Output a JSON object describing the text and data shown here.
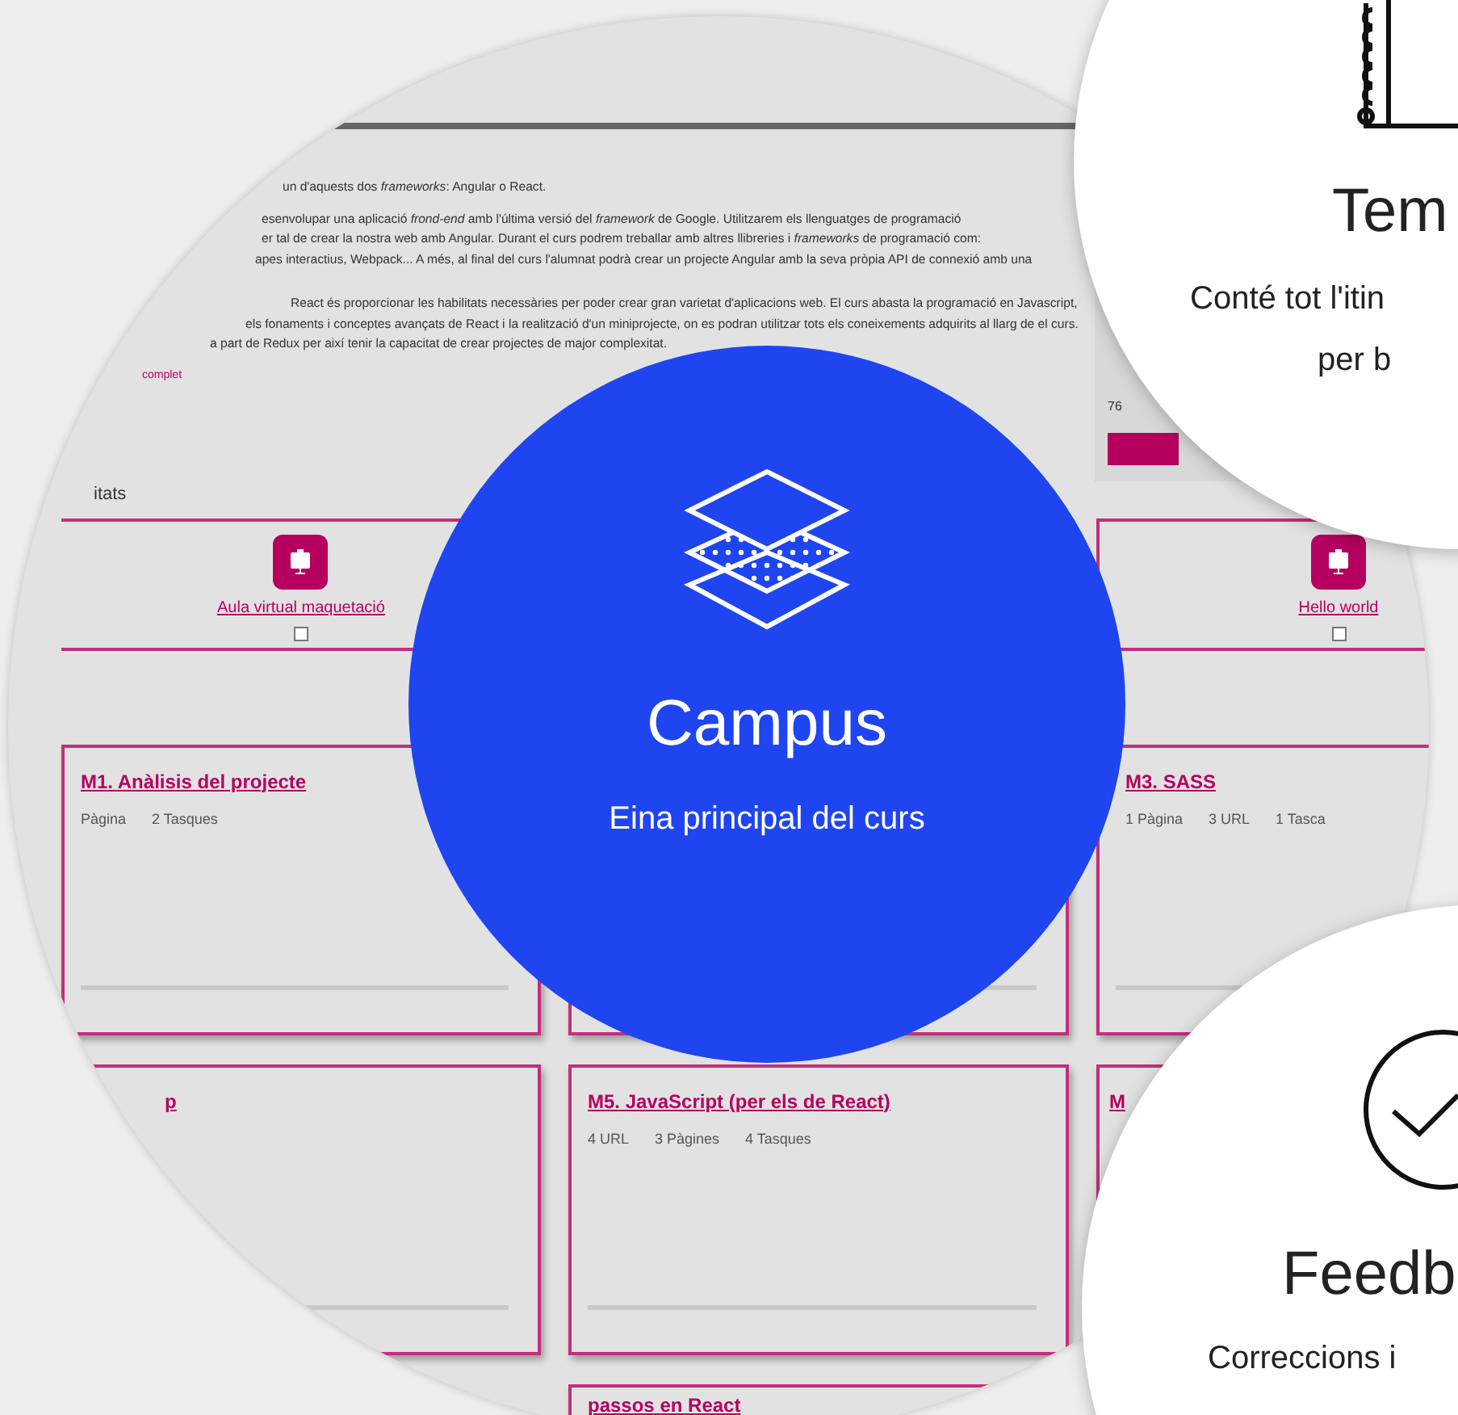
{
  "course_page": {
    "intro_lines": [
      "un d'aquests dos *frameworks*: Angular o React.",
      "esenvolupar una aplicació *frond-end* amb l'última versió del *framework* de Google. Utilitzarem els llenguatges de programació",
      "er tal de crear la nostra web amb Angular. Durant el curs podrem treballar amb altres llibreries i *frameworks* de programació com:",
      "apes interactius, Webpack... A més, al final del curs l'alumnat podrà crear un projecte Angular amb la seva pròpia API de connexió amb una",
      "React és proporcionar les habilitats necessàries per poder crear gran varietat d'aplicacions web. El curs abasta la programació en Javascript,",
      "els fonaments i conceptes avançats de React i la realització d'un miniprojecte, on es podran utilitzar tots els coneixements adquirits al llarg de el curs.",
      "a part de Redux per així tenir la capacitat de crear projectes de major complexitat."
    ],
    "link": "complet",
    "side_panel": {
      "count": "76"
    },
    "activities": {
      "heading": "itats",
      "items": [
        {
          "label": "Aula virtual maquetació",
          "checked": false
        },
        {
          "label": "Hello world",
          "checked": false
        }
      ]
    },
    "modules": [
      {
        "title": "M1. Anàlisis del projecte",
        "stats": [
          "Pàgina",
          "2 Tasques"
        ]
      },
      {
        "title": "M3. SASS",
        "stats": [
          "1 Pàgina",
          "3 URL",
          "1 Tasca"
        ]
      },
      {
        "title": "p"
      },
      {
        "title": "M5. JavaScript (per els de React)",
        "stats": [
          "4 URL",
          "3 Pàgines",
          "4 Tasques"
        ]
      },
      {
        "title": "M"
      },
      {
        "title": "passos en React"
      }
    ]
  },
  "features": [
    {
      "kind": "campus",
      "title": "Campus",
      "lines": [
        "Eina principal del curs"
      ]
    },
    {
      "kind": "themes",
      "title": "Tem",
      "lines": [
        "Conté tot l'itin",
        "per b"
      ]
    },
    {
      "kind": "feedback",
      "title": "Feedb",
      "lines": [
        "Correccions i"
      ]
    }
  ]
}
